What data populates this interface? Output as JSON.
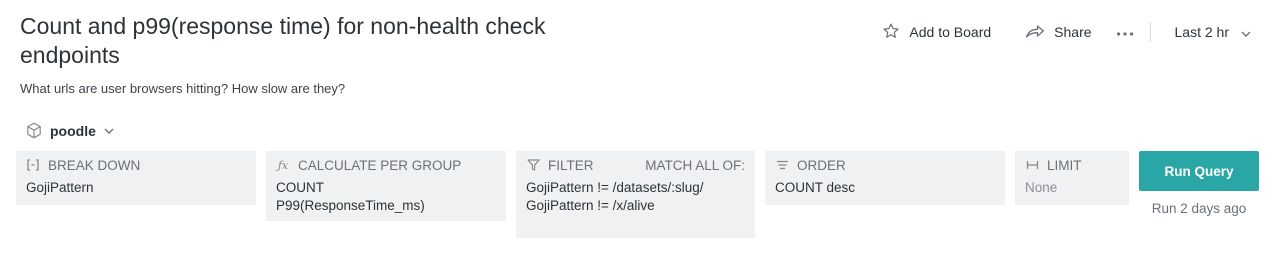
{
  "header": {
    "title": "Count and p99(response time) for non-health check endpoints",
    "subtitle": "What urls are user browsers hitting? How slow are they?"
  },
  "toolbar": {
    "add_to_board": "Add to Board",
    "share": "Share",
    "time_range": "Last 2 hr"
  },
  "dataset": {
    "name": "poodle"
  },
  "query": {
    "break_down": {
      "label": "BREAK DOWN",
      "values": [
        "GojiPattern"
      ]
    },
    "calculate": {
      "label": "CALCULATE PER GROUP",
      "values": [
        "COUNT",
        "P99(ResponseTime_ms)"
      ]
    },
    "filter": {
      "label": "FILTER",
      "match": "MATCH ALL OF:",
      "values": [
        "GojiPattern != /datasets/:slug/",
        "GojiPattern != /x/alive"
      ]
    },
    "order": {
      "label": "ORDER",
      "values": [
        "COUNT desc"
      ]
    },
    "limit": {
      "label": "LIMIT",
      "value": "None"
    }
  },
  "run": {
    "label": "Run Query",
    "last_run": "Run 2 days ago"
  },
  "colors": {
    "accent": "#2ba6a6",
    "panel_bg": "#f0f1f2"
  }
}
